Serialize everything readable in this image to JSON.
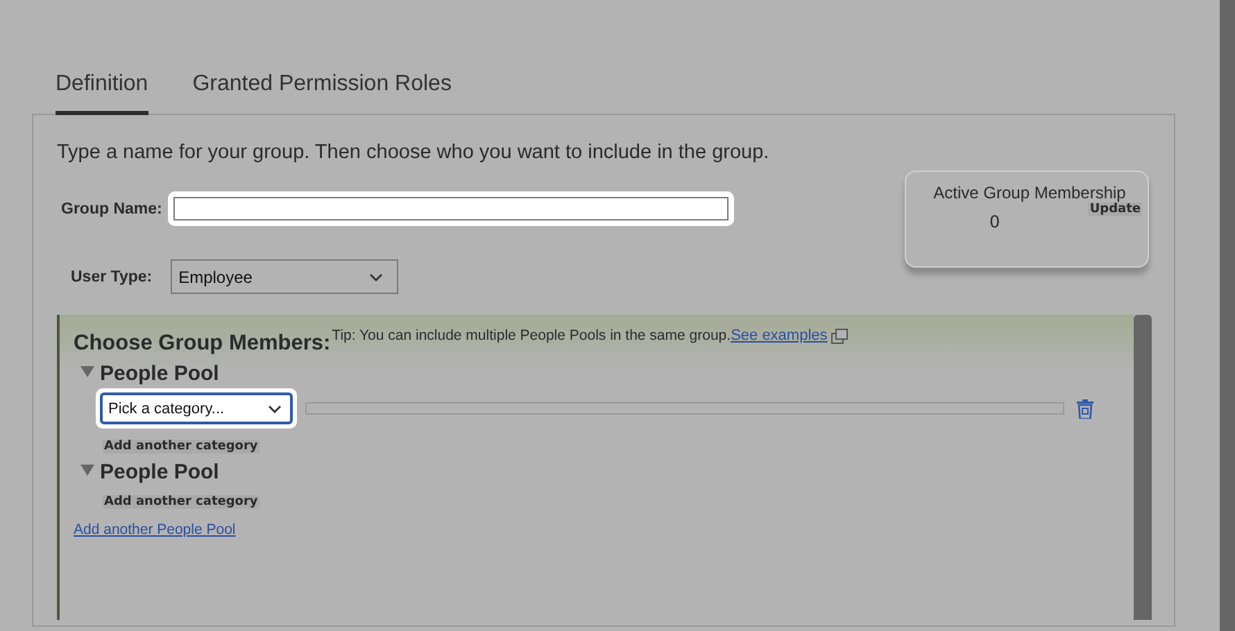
{
  "tabs": [
    {
      "label": "Definition",
      "selected": true
    },
    {
      "label": "Granted Permission Roles",
      "selected": false
    }
  ],
  "intro": "Type a name for your group. Then choose who you want to include in the group.",
  "group_name": {
    "label": "Group Name:",
    "highlighted": true
  },
  "user_type": {
    "label": "User Type:",
    "value": "Employee"
  },
  "membership": {
    "title": "Active Group Membership",
    "update": "Update",
    "count": "0"
  },
  "members": {
    "title": "Choose Group Members:",
    "tip": "Tip: You can include multiple People Pools in the same group.",
    "tip_link": "See examples",
    "pools": [
      {
        "title": "People Pool",
        "expanded": true,
        "categories": [
          {
            "value": "Pick a category...",
            "highlighted": true
          }
        ],
        "add_category": "Add another category"
      },
      {
        "title": "People Pool",
        "expanded": true,
        "add_category": "Add another category"
      }
    ],
    "add_pool": "Add another People Pool"
  }
}
